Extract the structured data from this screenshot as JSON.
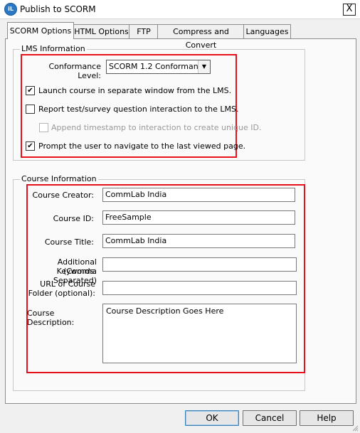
{
  "window": {
    "title": "Publish to SCORM",
    "close_glyph": "X",
    "icon_text": "iL"
  },
  "tabs": [
    {
      "label": "SCORM Options",
      "active": true
    },
    {
      "label": "HTML Options",
      "active": false
    },
    {
      "label": "FTP",
      "active": false
    },
    {
      "label": "Compress and Convert",
      "active": false
    },
    {
      "label": "Languages",
      "active": false
    }
  ],
  "lms": {
    "group_title": "LMS Information",
    "conformance_label": "Conformance Level:",
    "conformance_value": "SCORM 1.2 Conformant",
    "options": [
      {
        "label": "Launch course in separate window from the LMS.",
        "checked": true,
        "enabled": true
      },
      {
        "label": "Report test/survey question interaction to the LMS.",
        "checked": false,
        "enabled": true
      },
      {
        "label": "Append timestamp to interaction to create unique ID.",
        "checked": false,
        "enabled": false
      },
      {
        "label": "Prompt the user to navigate to the last viewed page.",
        "checked": true,
        "enabled": true
      }
    ]
  },
  "course": {
    "group_title": "Course Information",
    "creator_label": "Course Creator:",
    "creator_value": "CommLab India",
    "id_label": "Course ID:",
    "id_value": "FreeSample",
    "title_label": "Course Title:",
    "title_value": "CommLab India",
    "keywords_label_1": "Additional Keywords:",
    "keywords_label_2": "(Comma Separated)",
    "keywords_value": "",
    "url_label_1": "URL of Course",
    "url_label_2": "Folder (optional):",
    "url_value": "",
    "description_label": "Course Description:",
    "description_value": "Course Description Goes Here"
  },
  "buttons": {
    "ok": "OK",
    "cancel": "Cancel",
    "help": "Help"
  },
  "colors": {
    "highlight_border": "#e8111b",
    "app_icon": "#2b79c6"
  },
  "icons": {
    "check": "✔",
    "dropdown": "▼"
  }
}
